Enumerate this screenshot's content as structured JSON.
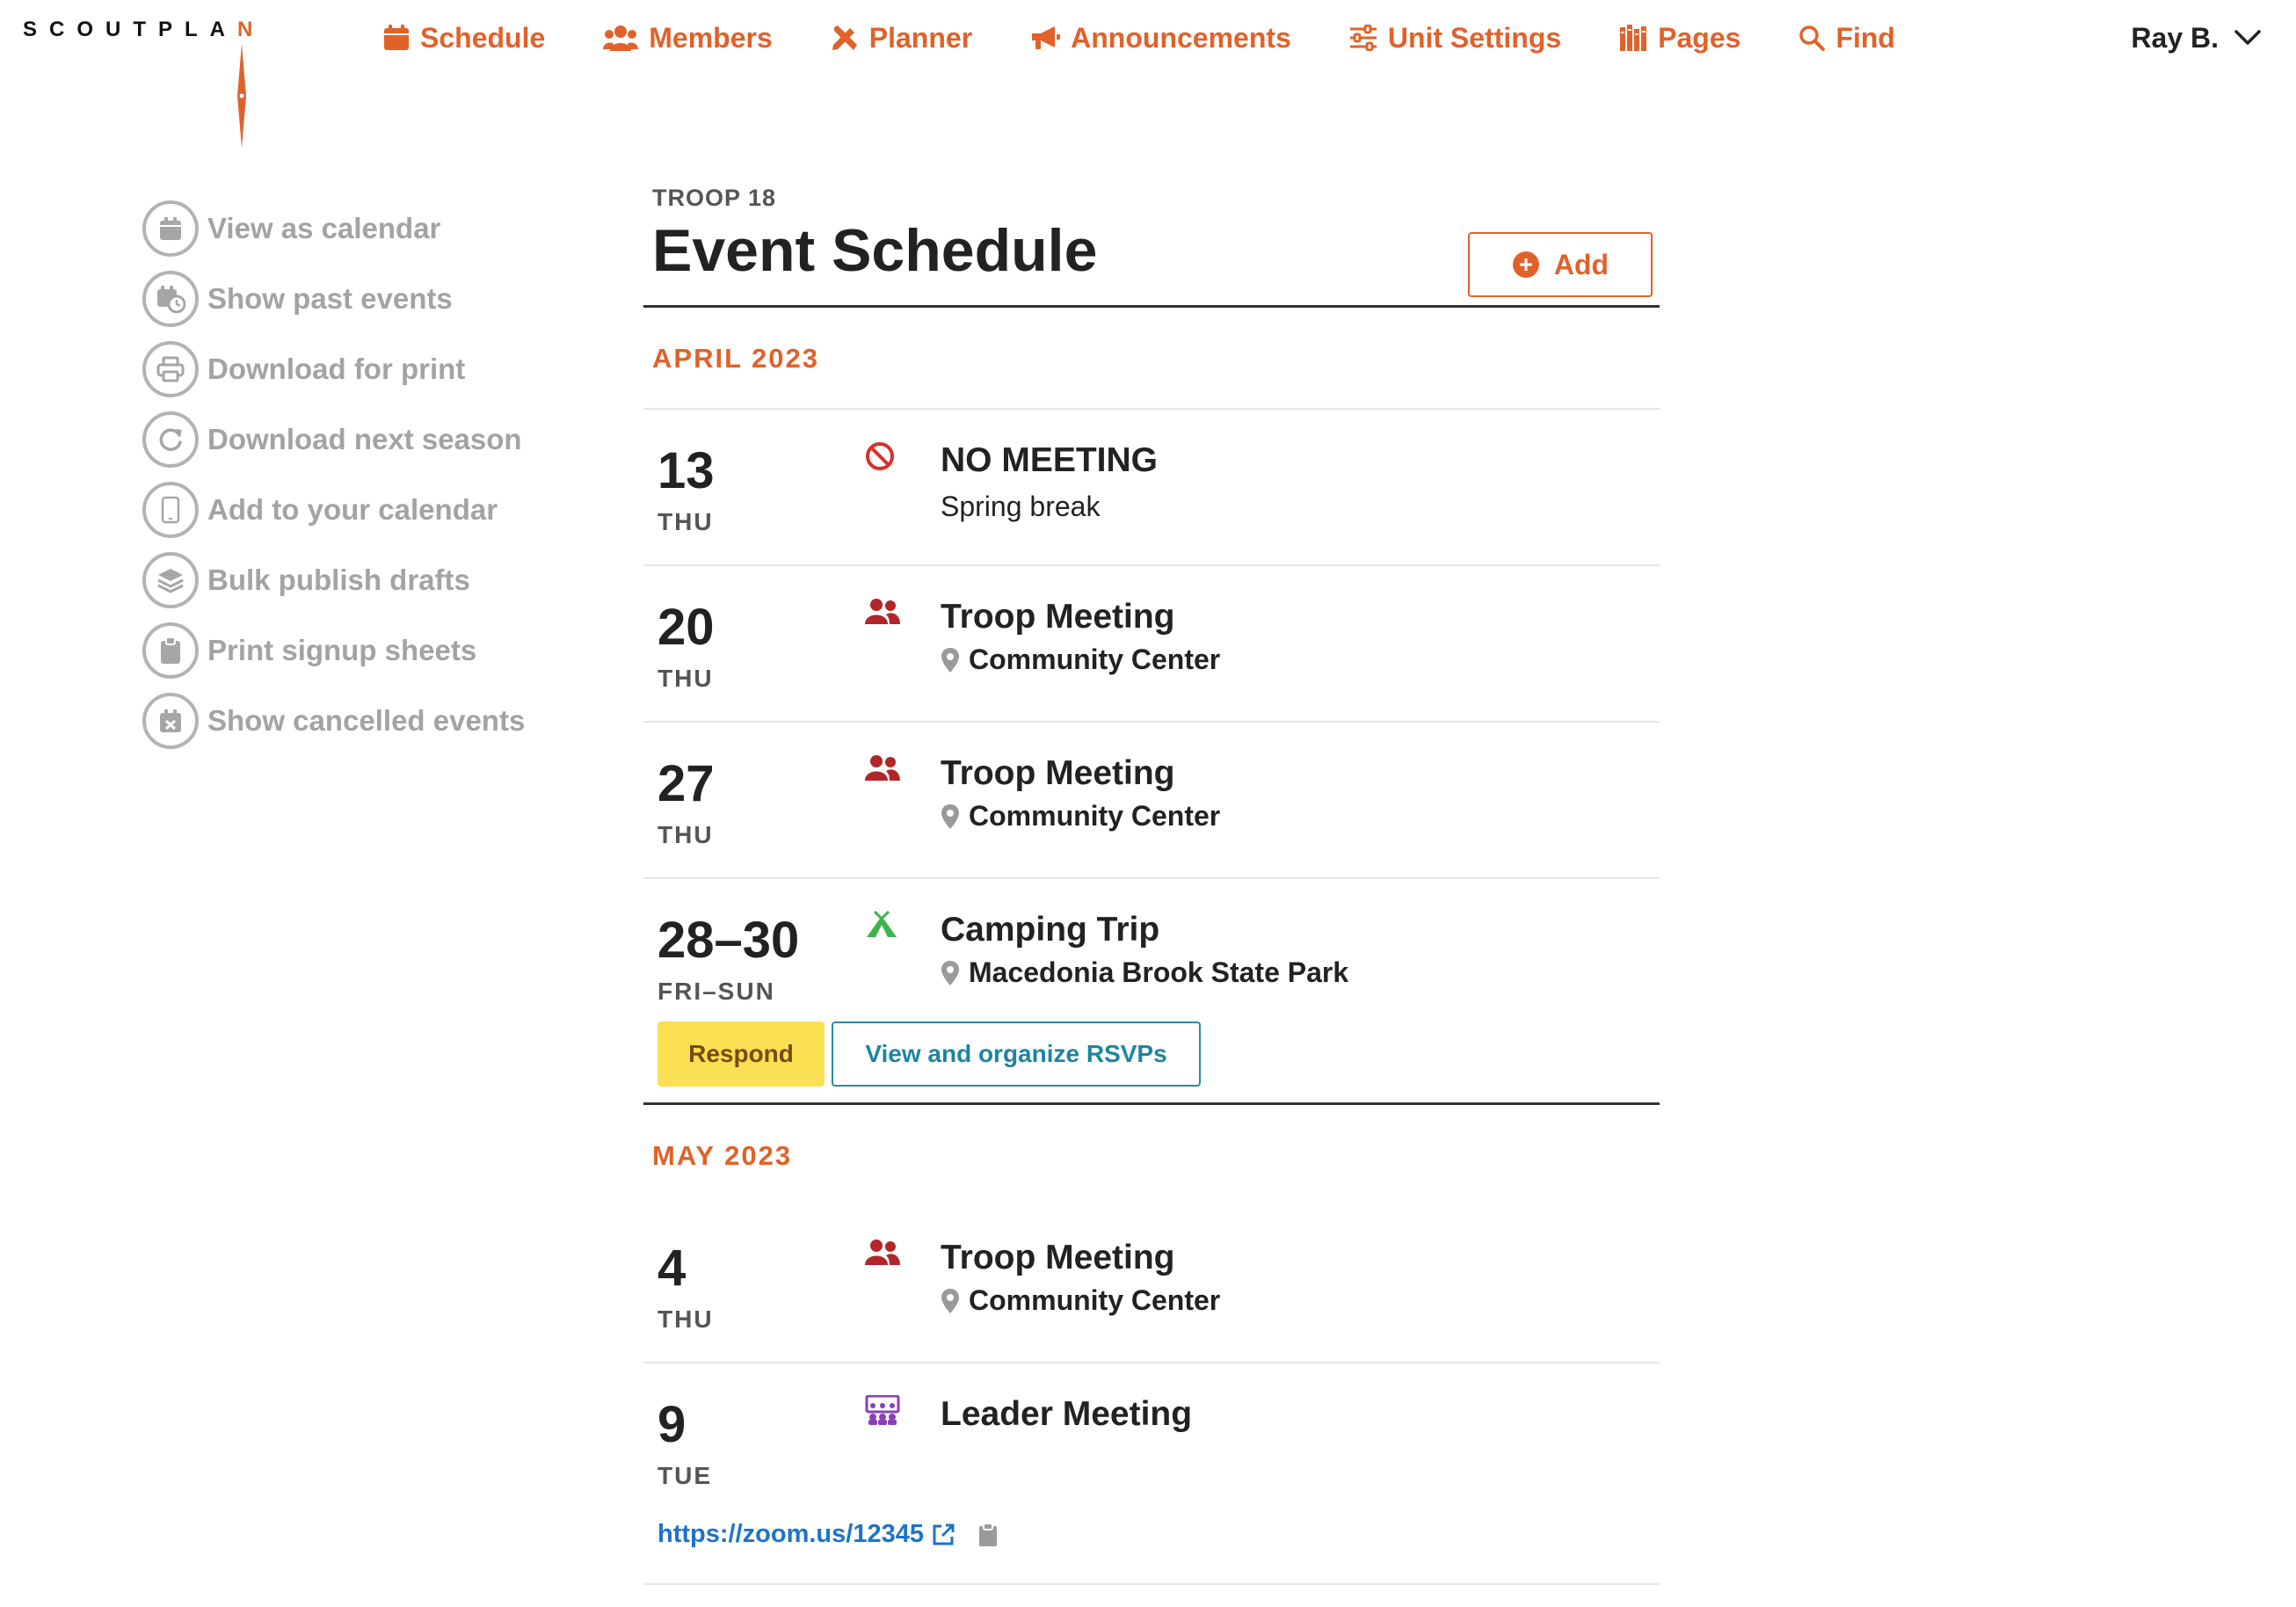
{
  "brand": {
    "logo_main": "SCOUTPLA",
    "logo_accent": "N",
    "accent_color": "#e0622a"
  },
  "nav": {
    "items": [
      {
        "label": "Schedule",
        "icon": "calendar-icon"
      },
      {
        "label": "Members",
        "icon": "users-icon"
      },
      {
        "label": "Planner",
        "icon": "pencil-ruler-icon"
      },
      {
        "label": "Announcements",
        "icon": "megaphone-icon"
      },
      {
        "label": "Unit Settings",
        "icon": "sliders-icon"
      },
      {
        "label": "Pages",
        "icon": "books-icon"
      },
      {
        "label": "Find",
        "icon": "search-icon"
      }
    ],
    "user": "Ray B."
  },
  "sidebar": {
    "items": [
      {
        "label": "View as calendar",
        "icon": "calendar-icon"
      },
      {
        "label": "Show past events",
        "icon": "calendar-clock-icon"
      },
      {
        "label": "Download for print",
        "icon": "printer-icon"
      },
      {
        "label": "Download next season",
        "icon": "refresh-icon"
      },
      {
        "label": "Add to your calendar",
        "icon": "phone-icon"
      },
      {
        "label": "Bulk publish drafts",
        "icon": "layers-icon"
      },
      {
        "label": "Print signup sheets",
        "icon": "clipboard-icon"
      },
      {
        "label": "Show cancelled events",
        "icon": "calendar-x-icon"
      }
    ]
  },
  "main": {
    "unit": "TROOP 18",
    "title": "Event Schedule",
    "add_label": "Add",
    "months": [
      {
        "label": "APRIL 2023",
        "events": [
          {
            "day": "13",
            "dow": "THU",
            "type": "no-meeting",
            "name": "NO MEETING",
            "subtitle": "Spring break"
          },
          {
            "day": "20",
            "dow": "THU",
            "type": "troop-meeting",
            "name": "Troop Meeting",
            "location": "Community Center"
          },
          {
            "day": "27",
            "dow": "THU",
            "type": "troop-meeting",
            "name": "Troop Meeting",
            "location": "Community Center"
          },
          {
            "day": "28–30",
            "dow": "FRI–SUN",
            "type": "camping",
            "name": "Camping Trip",
            "location": "Macedonia Brook State Park",
            "respond_label": "Respond",
            "rsvp_label": "View and organize RSVPs"
          }
        ]
      },
      {
        "label": "MAY 2023",
        "events": [
          {
            "day": "4",
            "dow": "THU",
            "type": "troop-meeting",
            "name": "Troop Meeting",
            "location": "Community Center"
          },
          {
            "day": "9",
            "dow": "TUE",
            "type": "leader-meeting",
            "name": "Leader Meeting",
            "link": "https://zoom.us/12345"
          }
        ]
      }
    ]
  },
  "colors": {
    "no_meeting": "#d9302c",
    "troop_meeting": "#b2262a",
    "camping": "#3cb54a",
    "leader_meeting": "#8a3fb8",
    "respond_bg": "#fae052",
    "rsvp_border": "#2a8aa0",
    "link": "#1e73c8"
  }
}
